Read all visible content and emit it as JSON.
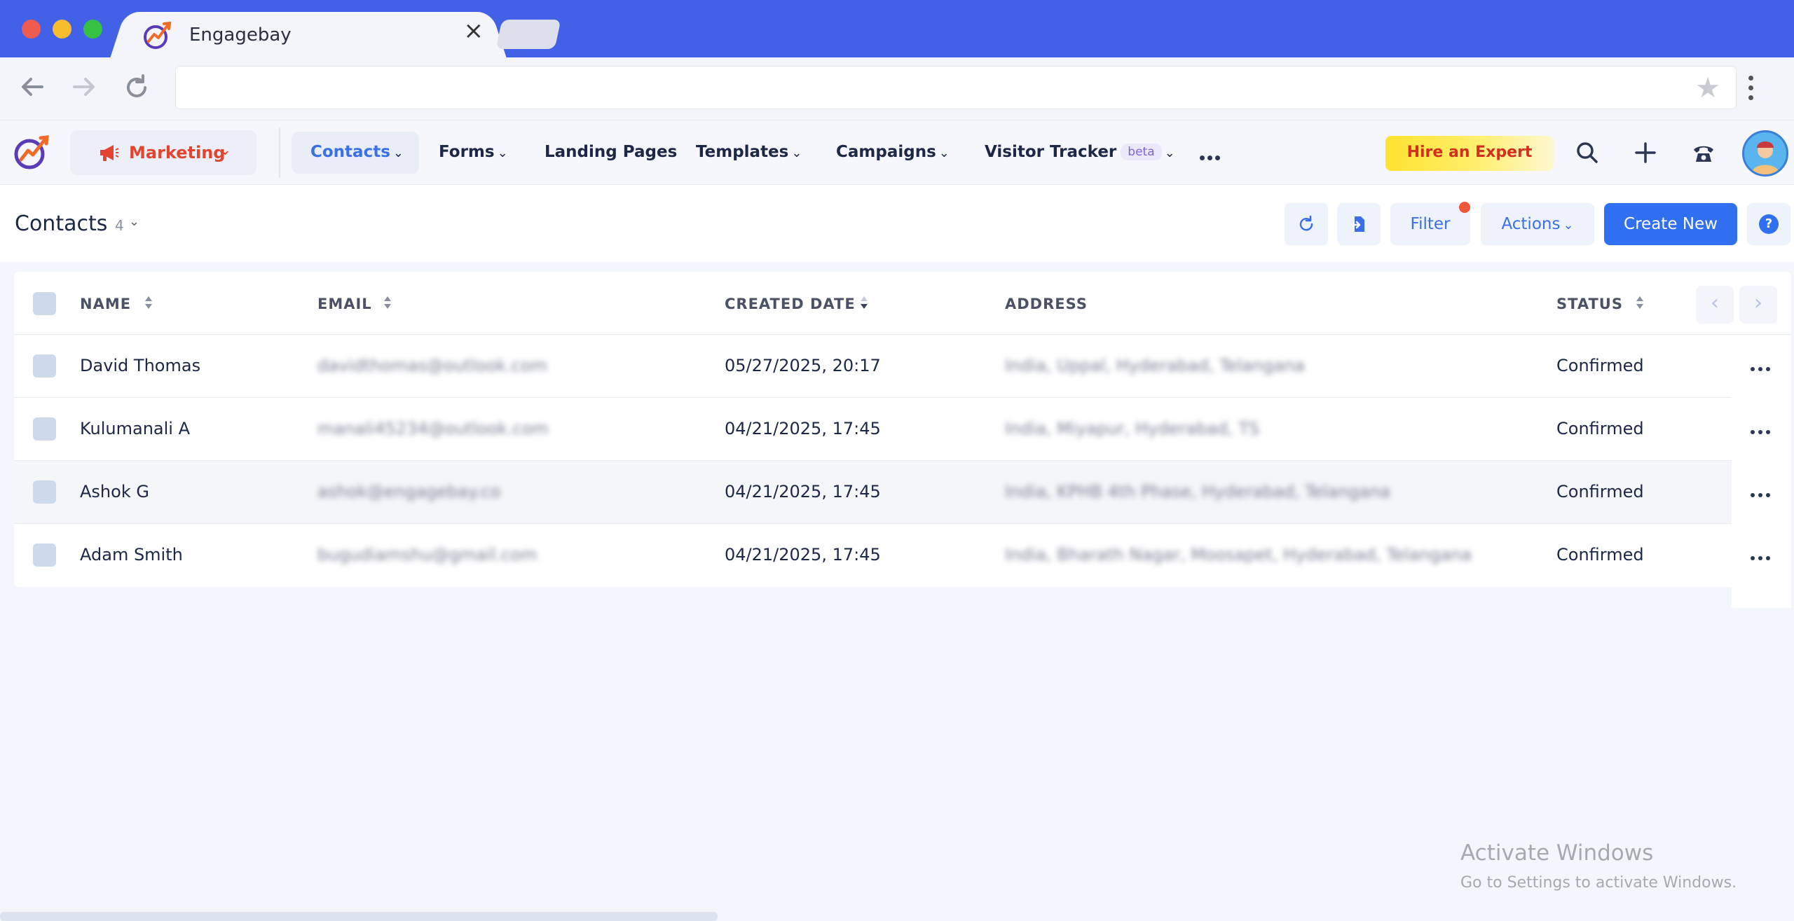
{
  "browser": {
    "tab_title": "Engagebay",
    "address": ""
  },
  "app": {
    "module_label": "Marketing",
    "nav": [
      {
        "label": "Contacts",
        "chevron": "⌄",
        "active": true
      },
      {
        "label": "Forms",
        "chevron": "⌄"
      },
      {
        "label": "Landing Pages",
        "chevron": ""
      },
      {
        "label": "Templates",
        "chevron": "⌄"
      },
      {
        "label": "Campaigns",
        "chevron": "⌄"
      },
      {
        "label": "Visitor Tracker",
        "badge": "beta",
        "chevron": "⌄"
      }
    ],
    "hire_label": "Hire an Expert",
    "header_icons": [
      "search-icon",
      "plus-icon",
      "phone-icon",
      "user-avatar"
    ]
  },
  "page": {
    "title": "Contacts",
    "count": "4",
    "filter_label": "Filter",
    "actions_label": "Actions",
    "create_label": "Create New",
    "help_label": "?"
  },
  "table": {
    "columns": {
      "name": "NAME",
      "email": "EMAIL",
      "created": "CREATED DATE",
      "address": "ADDRESS",
      "status": "STATUS"
    },
    "rows": [
      {
        "name": "David Thomas",
        "email": "davidthomas@outlook.com",
        "created": "05/27/2025, 20:17",
        "address": "India, Uppal, Hyderabad, Telangana",
        "status": "Confirmed"
      },
      {
        "name": "Kulumanali A",
        "email": "manali45234@outlook.com",
        "created": "04/21/2025, 17:45",
        "address": "India, Miyapur, Hyderabad, TS",
        "status": "Confirmed"
      },
      {
        "name": "Ashok G",
        "email": "ashok@engagebay.co",
        "created": "04/21/2025, 17:45",
        "address": "India, KPHB 4th Phase, Hyderabad, Telangana",
        "status": "Confirmed"
      },
      {
        "name": "Adam Smith",
        "email": "bugudiamshu@gmail.com",
        "created": "04/21/2025, 17:45",
        "address": "India, Bharath Nagar, Moosapet, Hyderabad, Telangana",
        "status": "Confirmed"
      }
    ]
  },
  "os": {
    "watermark_title": "Activate Windows",
    "watermark_sub": "Go to Settings to activate Windows."
  },
  "colors": {
    "chrome_blue": "#4361e6",
    "primary": "#2f6ff0",
    "marketing_red": "#e2442f",
    "hire_yellow": "#ffe32f"
  }
}
